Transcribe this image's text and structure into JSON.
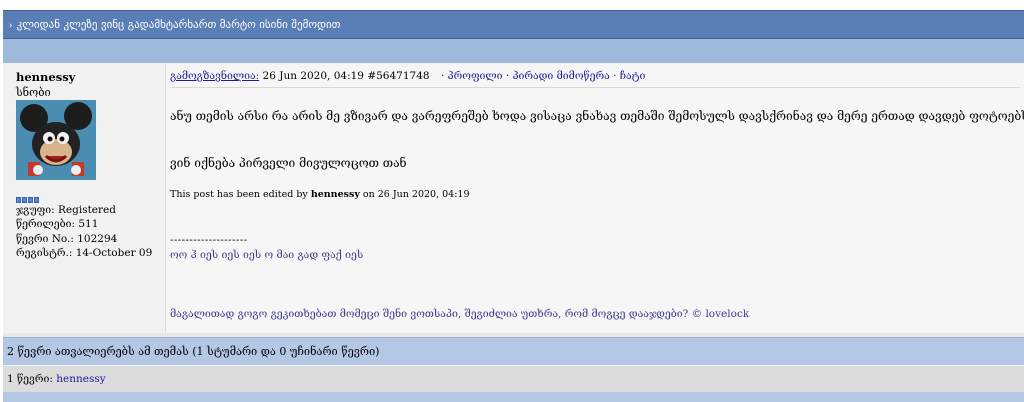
{
  "topic": {
    "title": "კლიდან კლეზე ვინც გადამხტარხართ მარტო ისინი შემოდით"
  },
  "post": {
    "author": {
      "username": "hennessy",
      "role": "სნობი",
      "group": "ჯგუფი: Registered",
      "posts": "წერილები: 511",
      "member_no": "წევრი No.: 102294",
      "registered": "რეგისტრ.: 14-October 09"
    },
    "header": {
      "posted_label": "გამოგზავნილია:",
      "date": "26 Jun 2020, 04:19",
      "post_id": "#56471748",
      "links": "· პროფილი · პირადი მიმოწერა · ჩატი"
    },
    "body": {
      "line1": "ანუ თემის არსი რა არის მე ვზივარ და ვარეფრეშებ ხოდა ვისაცა ვნახავ თემაში შემოსულს დავსქრინავ და მერე ერთად დავდებ ფოტოებს",
      "line2": "ვინ იქნება პირველი მივულოცოთ თან",
      "edited_prefix": "This post has been edited by",
      "edited_user": "hennessy",
      "edited_suffix": "on 26 Jun 2020, 04:19"
    },
    "signature": {
      "divider": "--------------------",
      "line1": "ოო ჰ იეს იეს იეს ო მაი გად ფაქ იეს",
      "line2": "მაგალითად გოგო გეკითხებათ მომეცი შენი ვოთსაპი, შეგიძლია უთხრა, რომ მოგცე დააჯდები? © lovelock"
    }
  },
  "readers": {
    "summary": "2 წევრი ათვალიერებს ამ თემას (1 სტუმარი და 0 უჩინარი წევრი)",
    "members_label": "1 წევრი:",
    "members": "hennessy"
  },
  "colors": {
    "title_bar": "#5a7fb7",
    "sub_bar": "#9fb9dd",
    "link": "#1a1a9a",
    "readers_bar": "#b4c8e6"
  }
}
